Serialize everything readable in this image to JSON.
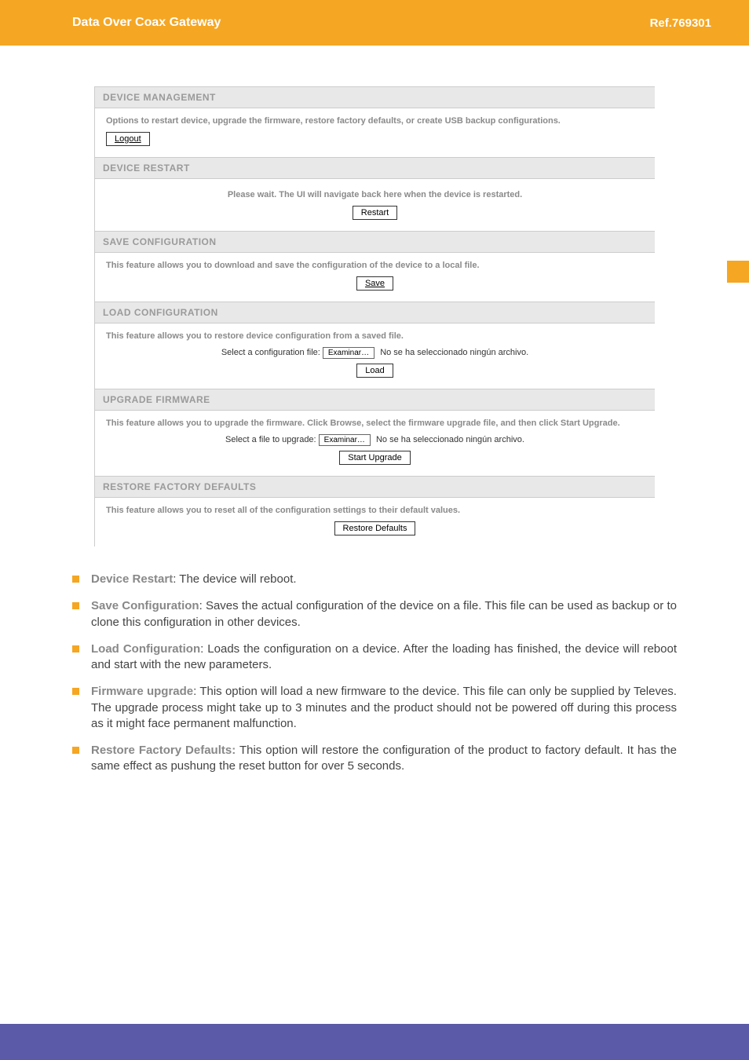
{
  "header": {
    "title": "Data Over Coax Gateway",
    "ref": "Ref.769301"
  },
  "panel": {
    "management": {
      "head": "DEVICE MANAGEMENT",
      "desc": "Options to restart device, upgrade the firmware, restore factory defaults, or create USB backup configurations.",
      "logout": "Logout"
    },
    "restart": {
      "head": "DEVICE RESTART",
      "desc": "Please wait. The UI will navigate back here when the device is restarted.",
      "btn": "Restart"
    },
    "saveconf": {
      "head": "SAVE CONFIGURATION",
      "desc": "This feature allows you to download and save the configuration of the device to a local file.",
      "btn": "Save"
    },
    "loadconf": {
      "head": "LOAD CONFIGURATION",
      "desc": "This feature allows you to restore device configuration from a saved file.",
      "selectlabel": "Select a configuration file:",
      "browse": "Examinar…",
      "filestatus": "No se ha seleccionado ningún archivo.",
      "btn": "Load"
    },
    "upgrade": {
      "head": "UPGRADE FIRMWARE",
      "desc": "This feature allows you to upgrade the firmware. Click Browse, select the firmware upgrade file, and then click Start Upgrade.",
      "selectlabel": "Select a file to upgrade:",
      "browse": "Examinar…",
      "filestatus": "No se ha seleccionado ningún archivo.",
      "btn": "Start Upgrade"
    },
    "restore": {
      "head": "RESTORE FACTORY DEFAULTS",
      "desc": "This feature allows you to reset all of the configuration settings to their default values.",
      "btn": "Restore Defaults"
    }
  },
  "bullets": [
    {
      "title": "Device Restart",
      "text": ": The device will reboot."
    },
    {
      "title": "Save Configuration",
      "text": ": Saves the actual configuration of the device on a file. This file can be used as backup or to clone this configuration in other devices."
    },
    {
      "title": "Load Configuration",
      "text": ": Loads the configuration on a device. After the loading has finished, the device will reboot and start with the new parameters."
    },
    {
      "title": "Firmware upgrade",
      "text": ": This option will load a new firmware to the device. This file can only be supplied by Televes. The upgrade process might take up to 3 minutes and the product should not be powered off during this process as it might face permanent malfunction."
    },
    {
      "title": "Restore Factory Defaults:",
      "text": "  This option will restore the configuration of the product to factory default. It has the same effect as pushung the reset button for over 5 seconds."
    }
  ]
}
